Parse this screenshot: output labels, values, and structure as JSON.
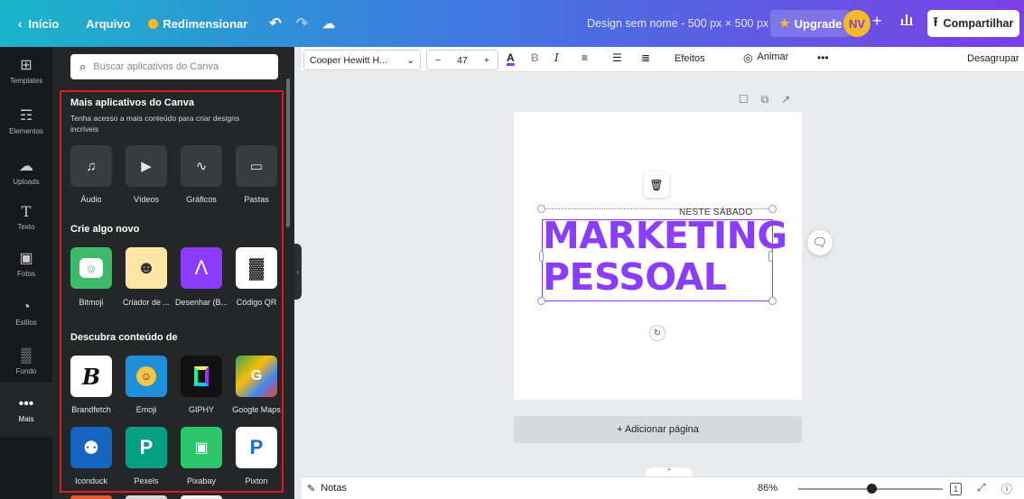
{
  "topbar": {
    "back_label": "Início",
    "file_label": "Arquivo",
    "resize_label": "Redimensionar",
    "document_title": "Design sem nome - 500 px × 500 px",
    "upgrade_label": "Upgrade",
    "avatar_initials": "NV",
    "share_label": "Compartilhar",
    "gradient_colors": [
      "#19b5c9",
      "#3f79e0",
      "#7b3fe4"
    ]
  },
  "rail": {
    "items": [
      {
        "label": "Templates",
        "icon": "templates-icon"
      },
      {
        "label": "Elementos",
        "icon": "elements-icon"
      },
      {
        "label": "Uploads",
        "icon": "upload-cloud-icon"
      },
      {
        "label": "Texto",
        "icon": "text-icon"
      },
      {
        "label": "Fotos",
        "icon": "photos-icon"
      },
      {
        "label": "Estilos",
        "icon": "styles-icon"
      },
      {
        "label": "Fundo",
        "icon": "background-icon"
      },
      {
        "label": "Mais",
        "icon": "more-icon"
      }
    ]
  },
  "panel": {
    "search_placeholder": "Buscar aplicativos do Canva",
    "section1": {
      "title": "Mais aplicativos do Canva",
      "subtitle": "Tenha acesso a mais conteúdo para criar designs incríveis",
      "apps": [
        "Áudio",
        "Vídeos",
        "Gráficos",
        "Pastas"
      ]
    },
    "section2": {
      "title": "Crie algo novo",
      "apps": [
        "Bitmoji",
        "Criador de ...",
        "Desenhar (B...",
        "Código QR"
      ]
    },
    "section3": {
      "title": "Descubra conteúdo de",
      "apps_row1": [
        "Brandfetch",
        "Emoji",
        "GIPHY",
        "Google Maps"
      ],
      "apps_row2": [
        "Iconduck",
        "Pexels",
        "Pixabay",
        "Pixton"
      ]
    }
  },
  "toolbar": {
    "font_name": "Cooper Hewitt H...",
    "font_size": "47",
    "effects_label": "Efeitos",
    "animate_label": "Animar",
    "ungroup_label": "Desagrupar"
  },
  "canvas": {
    "subline": "NESTE SÁBADO",
    "headline_line1": "MARKETING",
    "headline_line2": "PESSOAL",
    "headline_color": "#8b3dff",
    "add_page_label": "+ Adicionar página"
  },
  "statusbar": {
    "notes_label": "Notas",
    "zoom_label": "86%",
    "page_count": "1"
  }
}
